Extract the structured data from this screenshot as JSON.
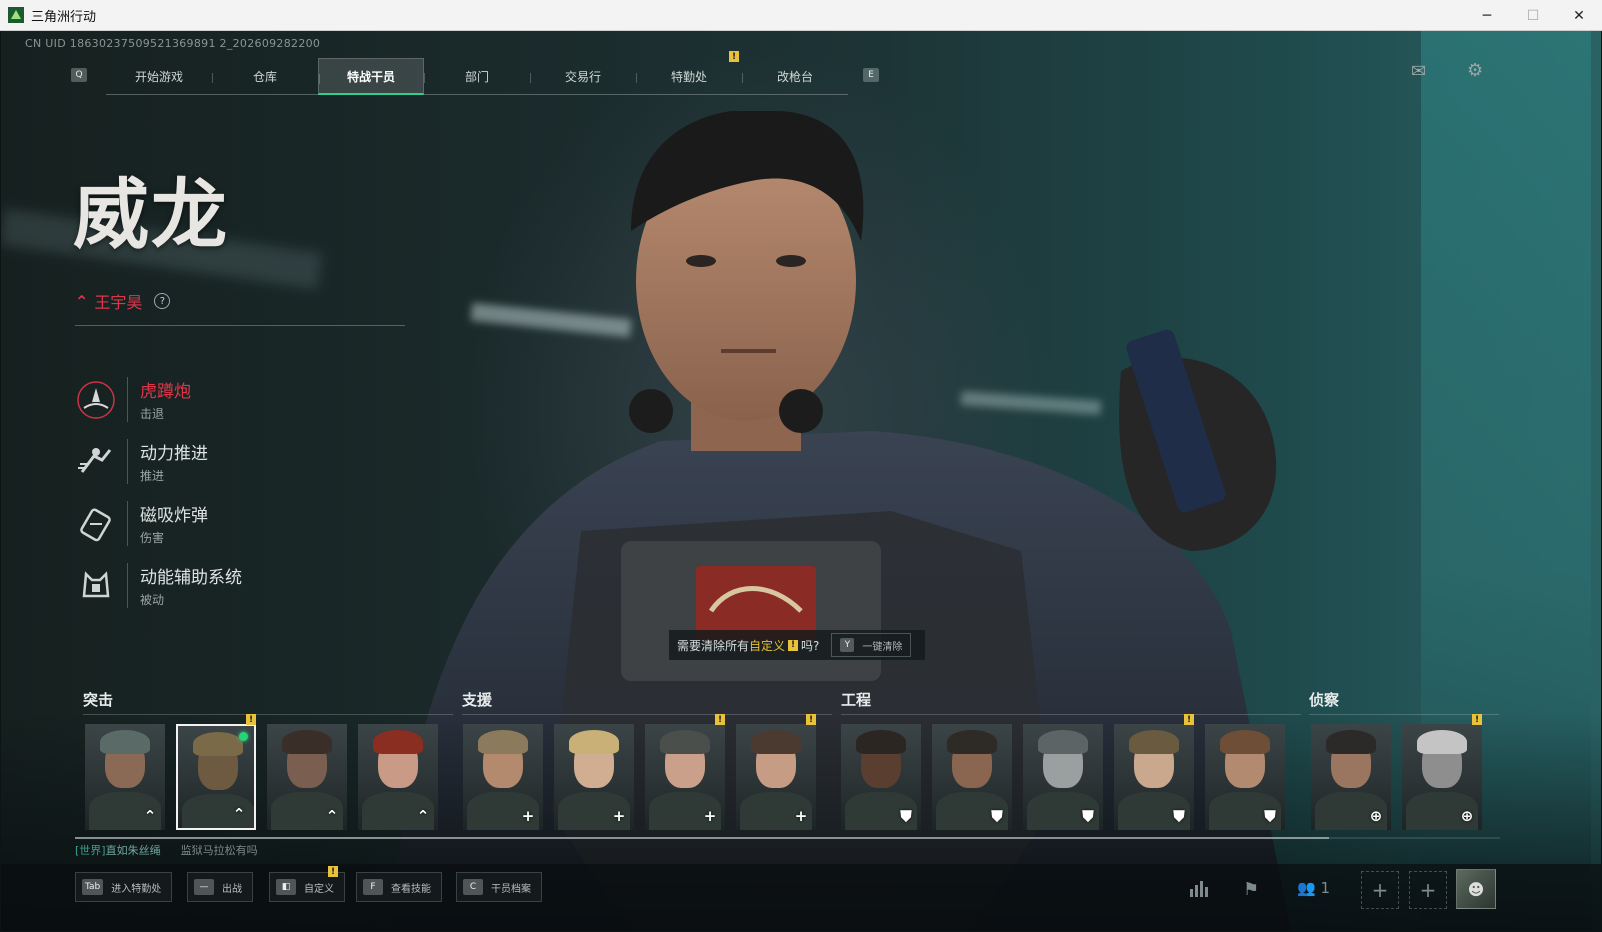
{
  "window": {
    "title": "三角洲行动",
    "minimize": "─",
    "maximize": "☐",
    "close": "✕"
  },
  "uid_text": "CN UID 18630237509521369891 2_202609282200",
  "nav": {
    "left_key": "Q",
    "right_key": "E",
    "tabs": [
      "开始游戏",
      "仓库",
      "特战干员",
      "部门",
      "交易行",
      "特勤处",
      "改枪台"
    ],
    "active_tab": "特战干员",
    "warning_tab": "特勤处",
    "warn_symbol": "!"
  },
  "operator": {
    "name": "威龙",
    "real_name": "王宇昊",
    "help": "?",
    "skills": [
      {
        "name": "虎蹲炮",
        "type": "击退",
        "icon": "mortar-icon",
        "active": true
      },
      {
        "name": "动力推进",
        "type": "推进",
        "icon": "dash-icon",
        "active": false
      },
      {
        "name": "磁吸炸弹",
        "type": "伤害",
        "icon": "magnet-bomb-icon",
        "active": false
      },
      {
        "name": "动能辅助系统",
        "type": "被动",
        "icon": "exo-system-icon",
        "active": false
      }
    ]
  },
  "clear_prompt": {
    "pre": "需要清除所有",
    "highlight": "自定义",
    "post": "吗?",
    "key": "Y",
    "button": "一键清除"
  },
  "classes": [
    {
      "label": "突击"
    },
    {
      "label": "支援"
    },
    {
      "label": "工程"
    },
    {
      "label": "侦察"
    }
  ],
  "roster": [
    {
      "class": "assault",
      "icon": "chevron-up-icon",
      "glyph": "⌃",
      "warn": false,
      "selected": false,
      "online": false,
      "skin": "#8a6a55",
      "hair": "#5a6a66"
    },
    {
      "class": "assault",
      "icon": "chevron-up-icon",
      "glyph": "⌃",
      "warn": true,
      "selected": true,
      "online": true,
      "skin": "#6e5a40",
      "hair": "#7a6a48"
    },
    {
      "class": "assault",
      "icon": "chevron-up-icon",
      "glyph": "⌃",
      "warn": false,
      "selected": false,
      "online": false,
      "skin": "#7a5e50",
      "hair": "#3a2e28"
    },
    {
      "class": "assault",
      "icon": "chevron-up-icon",
      "glyph": "⌃",
      "warn": false,
      "selected": false,
      "online": false,
      "skin": "#c99a86",
      "hair": "#8a2e22"
    },
    {
      "class": "support",
      "icon": "plus-icon",
      "glyph": "+",
      "warn": false,
      "selected": false,
      "online": false,
      "skin": "#b38a6e",
      "hair": "#8c7a5c"
    },
    {
      "class": "support",
      "icon": "plus-icon",
      "glyph": "+",
      "warn": false,
      "selected": false,
      "online": false,
      "skin": "#d1ad92",
      "hair": "#c8b077"
    },
    {
      "class": "support",
      "icon": "plus-icon",
      "glyph": "+",
      "warn": true,
      "selected": false,
      "online": false,
      "skin": "#caa08a",
      "hair": "#4a4f4b"
    },
    {
      "class": "support",
      "icon": "plus-icon",
      "glyph": "+",
      "warn": true,
      "selected": false,
      "online": false,
      "skin": "#c79c84",
      "hair": "#4b3a30"
    },
    {
      "class": "engineer",
      "icon": "shield-icon",
      "glyph": "⛊",
      "warn": false,
      "selected": false,
      "online": false,
      "skin": "#5a3f30",
      "hair": "#2c2622"
    },
    {
      "class": "engineer",
      "icon": "shield-icon",
      "glyph": "⛊",
      "warn": false,
      "selected": false,
      "online": false,
      "skin": "#8a6650",
      "hair": "#2e2a26"
    },
    {
      "class": "engineer",
      "icon": "shield-icon",
      "glyph": "⛊",
      "warn": false,
      "selected": false,
      "online": false,
      "skin": "#9aa0a0",
      "hair": "#5d6466"
    },
    {
      "class": "engineer",
      "icon": "shield-icon",
      "glyph": "⛊",
      "warn": true,
      "selected": false,
      "online": false,
      "skin": "#caa88e",
      "hair": "#6a5a40"
    },
    {
      "class": "engineer",
      "icon": "shield-icon",
      "glyph": "⛊",
      "warn": false,
      "selected": false,
      "online": false,
      "skin": "#b28a70",
      "hair": "#6e4e36"
    },
    {
      "class": "recon",
      "icon": "crosshair-icon",
      "glyph": "⊕",
      "warn": false,
      "selected": false,
      "online": false,
      "skin": "#9a7560",
      "hair": "#2c2a28"
    },
    {
      "class": "recon",
      "icon": "crosshair-icon",
      "glyph": "⊕",
      "warn": true,
      "selected": false,
      "online": false,
      "skin": "#8e8e8e",
      "hair": "#c4c4c4"
    }
  ],
  "roster_scroll_fraction": 0.88,
  "chat": {
    "channel": "[世界]",
    "sender": "直如朱丝绳",
    "message": "监狱马拉松有吗"
  },
  "hotkeys": [
    {
      "key": "Tab",
      "label": "进入特勤处"
    },
    {
      "key": "—",
      "label": "出战"
    },
    {
      "key": "◧",
      "label": "自定义",
      "warn": true
    },
    {
      "key": "F",
      "label": "查看技能"
    },
    {
      "key": "C",
      "label": "干员档案"
    }
  ],
  "bottom_right": {
    "stats_icon": "bar-chart-icon",
    "flag_icon": "flag-icon",
    "friends_icon": "friends-icon",
    "friends_count": "1",
    "slot_symbol": "+",
    "avatar_icon": "avatar-icon"
  },
  "colors": {
    "accent_green": "#2fd08e",
    "highlight_red": "#e0364a",
    "warning_yellow": "#e8c23a"
  }
}
